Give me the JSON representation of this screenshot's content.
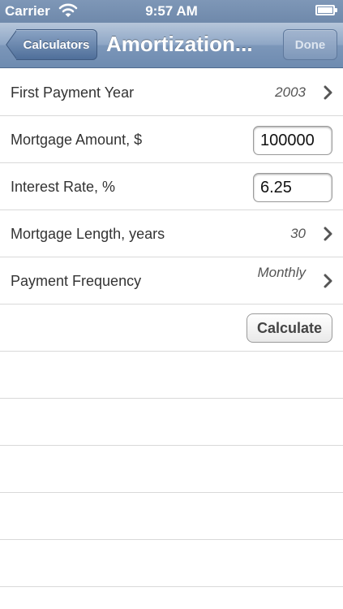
{
  "status_bar": {
    "carrier": "Carrier",
    "time": "9:57 AM",
    "wifi_icon": "wifi-icon",
    "battery_icon": "battery-icon"
  },
  "nav": {
    "back_label": "Calculators",
    "title": "Amortization...",
    "done_label": "Done"
  },
  "form": {
    "first_payment_year": {
      "label": "First Payment Year",
      "value": "2003"
    },
    "mortgage_amount": {
      "label": "Mortgage Amount, $",
      "value": "100000"
    },
    "interest_rate": {
      "label": "Interest Rate, %",
      "value": "6.25"
    },
    "mortgage_length": {
      "label": "Mortgage Length, years",
      "value": "30"
    },
    "payment_frequency": {
      "label": "Payment Frequency",
      "value": "Monthly"
    },
    "calculate_label": "Calculate"
  },
  "colors": {
    "nav_bar": "#7b96b9",
    "status_bar": "#7e97b7",
    "separator": "#d9d9d9"
  }
}
